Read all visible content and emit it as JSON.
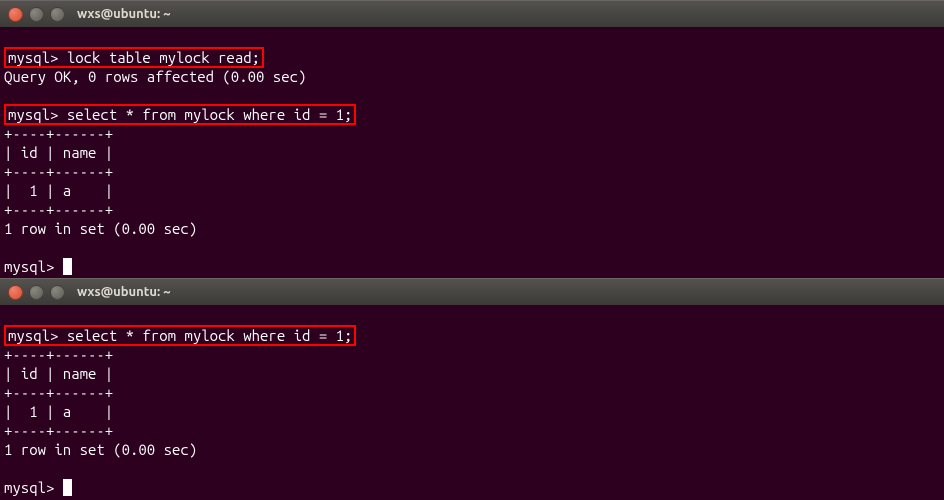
{
  "window1": {
    "title": "wxs@ubuntu: ~",
    "line1_prompt": "mysql> ",
    "line1_cmd": "lock table mylock read;",
    "line2": "Query OK, 0 rows affected (0.00 sec)",
    "line3": "",
    "line4_prompt": "mysql> ",
    "line4_cmd": "select * from mylock where id = 1;",
    "line5": "+----+------+",
    "line6": "| id | name |",
    "line7": "+----+------+",
    "line8": "|  1 | a    |",
    "line9": "+----+------+",
    "line10": "1 row in set (0.00 sec)",
    "line11": "",
    "line12_prompt": "mysql> "
  },
  "window2": {
    "title": "wxs@ubuntu: ~",
    "line1_prompt": "mysql> ",
    "line1_cmd": "select * from mylock where id = 1;",
    "line2": "+----+------+",
    "line3": "| id | name |",
    "line4": "+----+------+",
    "line5": "|  1 | a    |",
    "line6": "+----+------+",
    "line7": "1 row in set (0.00 sec)",
    "line8": "",
    "line9_prompt": "mysql> "
  }
}
